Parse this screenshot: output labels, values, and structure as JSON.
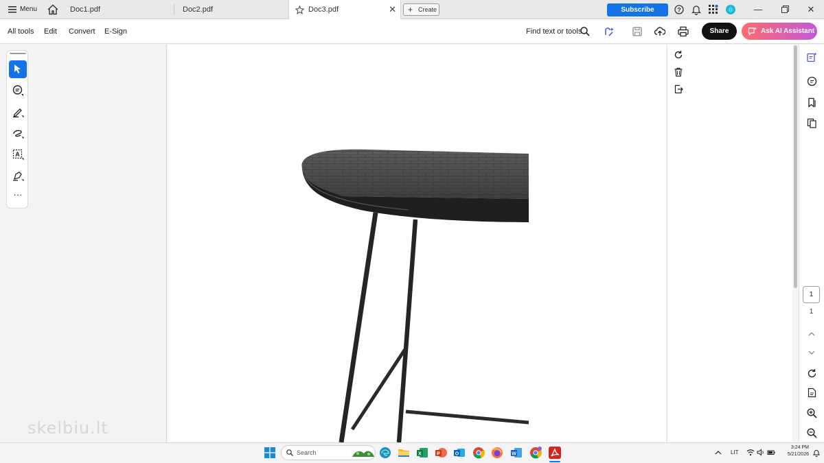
{
  "tabbar": {
    "menu_label": "Menu",
    "tabs": [
      {
        "label": "Doc1.pdf"
      },
      {
        "label": "Doc2.pdf"
      },
      {
        "label": "Doc3.pdf",
        "active": true
      }
    ],
    "create_label": "Create",
    "subscribe_label": "Subscribe"
  },
  "toolbar": {
    "menu": [
      "All tools",
      "Edit",
      "Convert",
      "E-Sign"
    ],
    "find_label": "Find text or tools",
    "share_label": "Share",
    "ai_label": "Ask AI Assistant"
  },
  "navigation": {
    "current_page": "1",
    "total_pages": "1"
  },
  "document": {
    "watermark": "skelbiu.lt"
  },
  "taskbar": {
    "search_placeholder": "Search",
    "language": "LIT",
    "time": "3:24 PM",
    "date": "5/21/2026"
  },
  "colors": {
    "accent": "#1473e6",
    "share_bg": "#111111",
    "ai_gradient_start": "#ff6b6b",
    "ai_gradient_end": "#c05ad8",
    "pdf_red": "#d3261d"
  }
}
